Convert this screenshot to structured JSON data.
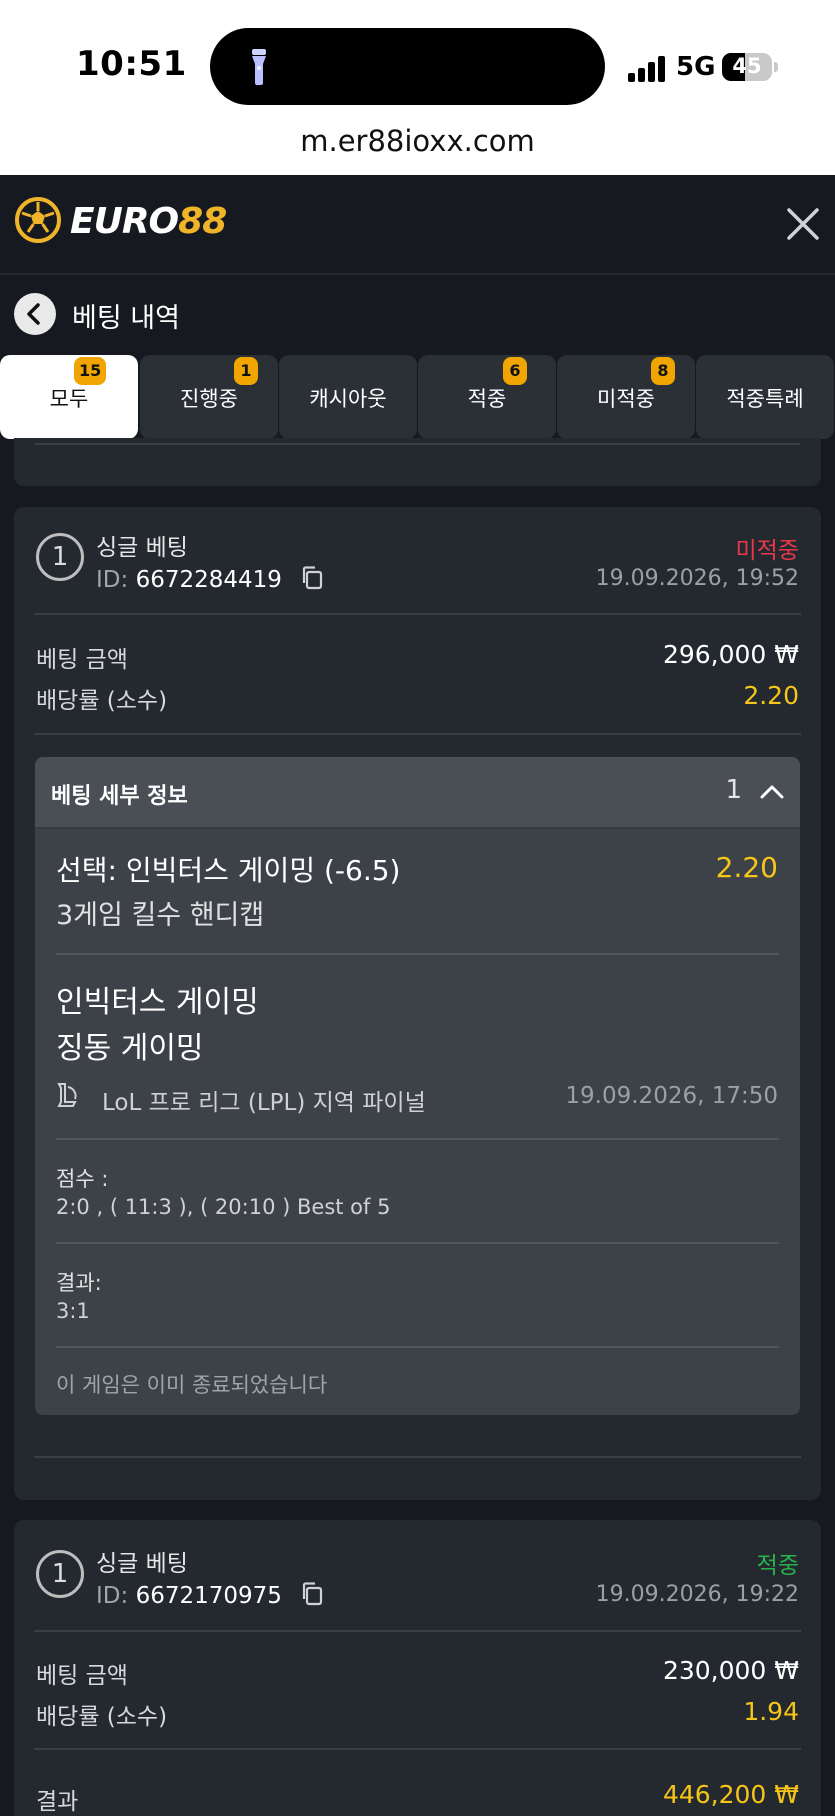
{
  "status_bar": {
    "time": "10:51",
    "network": "5G",
    "battery": "45",
    "battery_level": 0.45,
    "url": "m.er88ioxx.com"
  },
  "header": {
    "logo_white": "EURO",
    "logo_gold": "88",
    "brand_color": "#f0b429"
  },
  "page": {
    "title": "베팅 내역"
  },
  "tabs": [
    {
      "label": "모두",
      "badge": "15",
      "active": true
    },
    {
      "label": "진행중",
      "badge": "1"
    },
    {
      "label": "캐시아웃",
      "badge": ""
    },
    {
      "label": "적중",
      "badge": "6"
    },
    {
      "label": "미적중",
      "badge": "8"
    },
    {
      "label": "적중특례",
      "badge": ""
    }
  ],
  "bets": [
    {
      "number": "1",
      "type": "싱글 베팅",
      "id_prefix": "ID:",
      "id": "6672284419",
      "status": "미적중",
      "status_color": "#e8394a",
      "datetime": "19.09.2026, 19:52",
      "stake_label": "베팅 금액",
      "stake": "296,000 ₩",
      "odds_label": "배당률 (소수)",
      "odds": "2.20",
      "details": {
        "title": "베팅 세부 정보",
        "count": "1",
        "selection": "선택: 인빅터스 게이밍 (-6.5)",
        "selection_odds": "2.20",
        "market": "3게임 킬수 핸디캡",
        "team1": "인빅터스 게이밍",
        "team2": "징동 게이밍",
        "league": "LoL 프로 리그 (LPL) 지역 파이널",
        "event_datetime": "19.09.2026, 17:50",
        "score_label": "점수 :",
        "score": "2:0 , ( 11:3 ), ( 20:10 ) Best of 5",
        "result_label": "결과:",
        "result": "3:1",
        "note": "이 게임은 이미 종료되었습니다"
      }
    },
    {
      "number": "1",
      "type": "싱글 베팅",
      "id_prefix": "ID:",
      "id": "6672170975",
      "status": "적중",
      "status_color": "#27b34c",
      "datetime": "19.09.2026, 19:22",
      "stake_label": "베팅 금액",
      "stake": "230,000 ₩",
      "odds_label": "배당률 (소수)",
      "odds": "1.94",
      "payout_label": "결과",
      "payout": "446,200 ₩"
    }
  ]
}
